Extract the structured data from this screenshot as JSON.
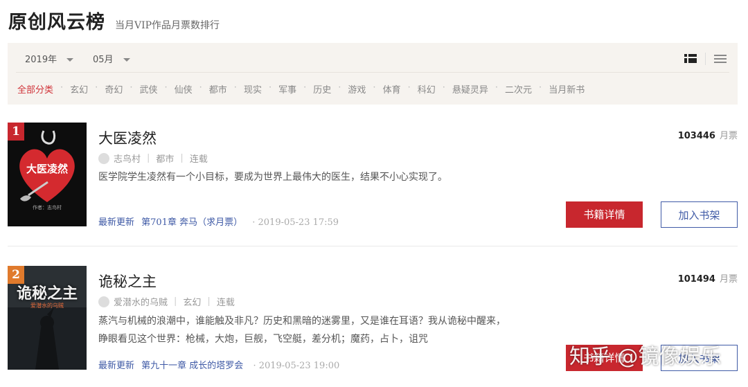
{
  "header": {
    "title": "原创风云榜",
    "subtitle": "当月VIP作品月票数排行"
  },
  "filters": {
    "year": "2019年",
    "month": "05月",
    "categories": [
      "全部分类",
      "玄幻",
      "奇幻",
      "武侠",
      "仙侠",
      "都市",
      "现实",
      "军事",
      "历史",
      "游戏",
      "体育",
      "科幻",
      "悬疑灵异",
      "二次元",
      "当月新书"
    ],
    "active_category": "全部分类"
  },
  "books": [
    {
      "rank": "1",
      "title": "大医凌然",
      "cover_text": "大医凌然",
      "cover_author": "作者：志鸟村",
      "author": "志鸟村",
      "genre": "都市",
      "status": "连载",
      "description": "医学院学生凌然有一个小目标，要成为世界上最伟大的医生，结果不小心实现了。",
      "update_label": "最新更新",
      "update_chapter": "第701章 奔马（求月票）",
      "update_time": "· 2019-05-23 17:59",
      "votes": "103446",
      "votes_unit": "月票",
      "detail_btn": "书籍详情",
      "shelf_btn": "加入书架"
    },
    {
      "rank": "2",
      "title": "诡秘之主",
      "cover_text": "诡秘之主",
      "cover_author": "爱潜水的乌贼",
      "author": "爱潜水的乌贼",
      "genre": "玄幻",
      "status": "连载",
      "description": "蒸汽与机械的浪潮中，谁能触及非凡？历史和黑暗的迷雾里，又是谁在耳语？我从诡秘中醒来，睁眼看见这个世界：枪械，大炮，巨舰，飞空艇，差分机；魔药，占卜，诅咒",
      "update_label": "最新更新",
      "update_chapter": "第九十一章 成长的塔罗会",
      "update_time": "· 2019-05-23 19:00",
      "votes": "101494",
      "votes_unit": "月票",
      "detail_btn": "书籍详情",
      "shelf_btn": "加入书架"
    }
  ],
  "watermark": "知乎 @镜像娱乐",
  "colors": {
    "accent_red": "#c8272e",
    "link_blue": "#3f5aa6",
    "filter_bg": "#f6f3ef"
  }
}
